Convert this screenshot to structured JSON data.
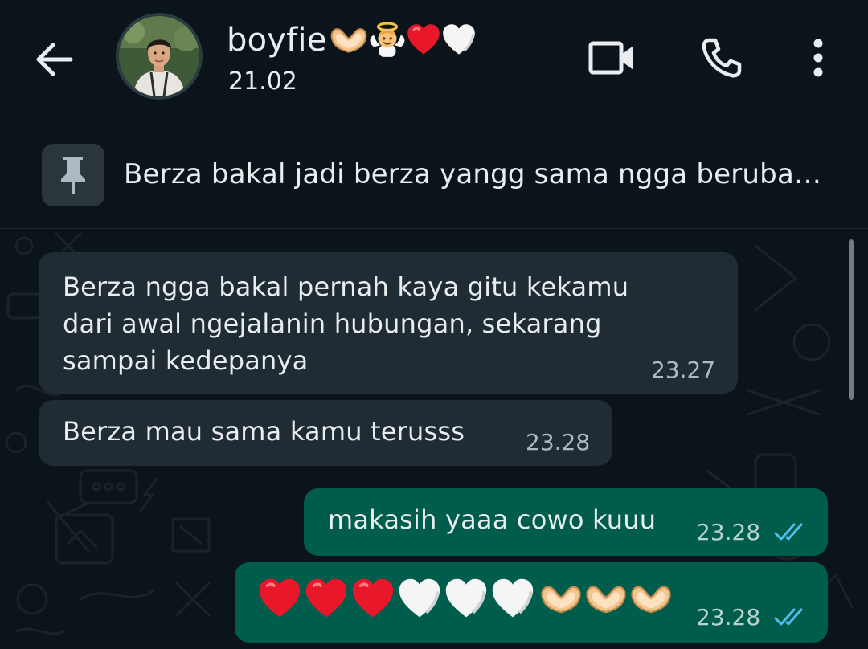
{
  "header": {
    "contact_name": "boyfie",
    "name_emojis": [
      "heart-hands-emoji",
      "baby-angel-emoji",
      "red-heart-emoji",
      "white-heart-emoji"
    ],
    "last_seen": "21.02",
    "icons": [
      "back-arrow-icon",
      "video-call-icon",
      "phone-icon",
      "more-options-icon"
    ]
  },
  "pinned": {
    "icon": "pin-icon",
    "text": "Berza bakal jadi berza yangg sama ngga beruba…"
  },
  "messages": [
    {
      "direction": "incoming",
      "lines": [
        "Berza ngga bakal pernah kaya gitu kekamu",
        "dari awal ngejalanin hubungan, sekarang",
        "sampai kedepanya"
      ],
      "time": "23.27"
    },
    {
      "direction": "incoming",
      "lines": [
        "Berza mau sama kamu terusss"
      ],
      "time": "23.28"
    },
    {
      "direction": "outgoing",
      "lines": [
        "makasih yaaa cowo kuuu"
      ],
      "time": "23.28",
      "status": "read-double-tick-icon"
    },
    {
      "direction": "outgoing",
      "emojis": [
        "red-heart-emoji",
        "red-heart-emoji",
        "red-heart-emoji",
        "white-heart-emoji",
        "white-heart-emoji",
        "white-heart-emoji",
        "heart-hands-emoji",
        "heart-hands-emoji",
        "heart-hands-emoji"
      ],
      "time": "23.28",
      "status": "read-double-tick-icon"
    }
  ],
  "colors": {
    "background": "#0b141a",
    "incoming_bubble": "#202c33",
    "outgoing_bubble": "#005c4b",
    "read_ticks": "#53bdeb"
  }
}
